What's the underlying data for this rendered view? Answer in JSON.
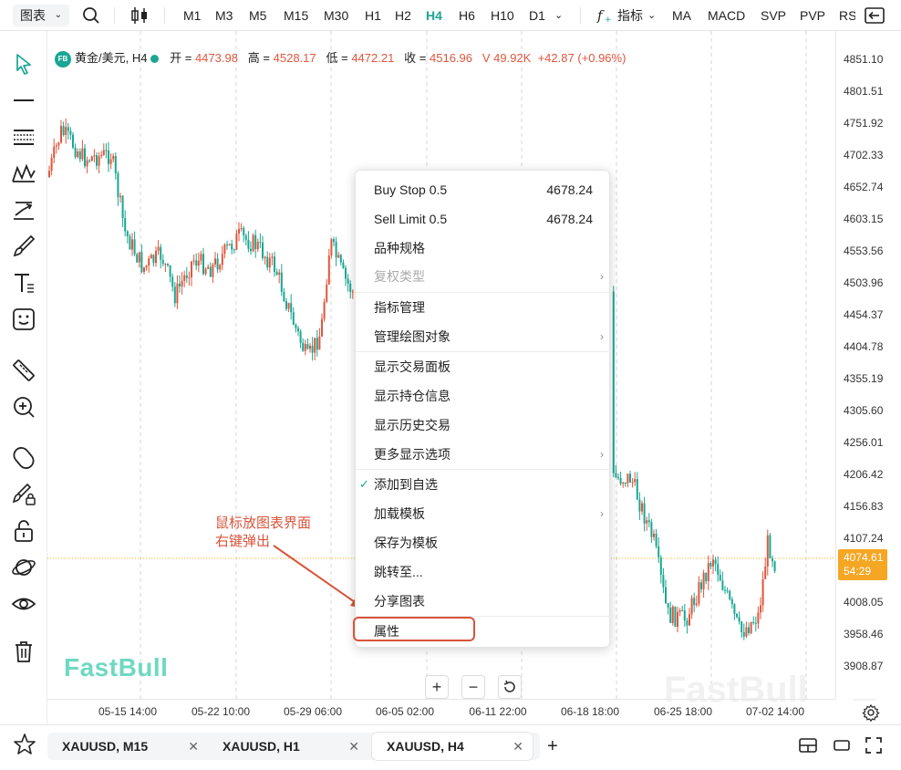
{
  "toolbar": {
    "chart_type_label": "图表",
    "timeframes": [
      "M1",
      "M3",
      "M5",
      "M15",
      "M30",
      "H1",
      "H2",
      "H4",
      "H6",
      "H10",
      "D1"
    ],
    "active_timeframe": "H4",
    "indicators_label": "指标",
    "quick_indicators": [
      "MA",
      "MACD",
      "SVP",
      "PVP",
      "RS"
    ]
  },
  "legend": {
    "badge": "FB",
    "symbol": "黄金/美元, H4",
    "open_label": "开 =",
    "open": "4473.98",
    "high_label": "高 =",
    "high": "4528.17",
    "low_label": "低 =",
    "low": "4472.21",
    "close_label": "收 =",
    "close": "4516.96",
    "vol_label": "V",
    "vol": "49.92K",
    "change": "+42.87 (+0.96%)"
  },
  "price_scale": [
    "4851.10",
    "4801.51",
    "4751.92",
    "4702.33",
    "4652.74",
    "4603.15",
    "4553.56",
    "4503.96",
    "4454.37",
    "4404.78",
    "4355.19",
    "4305.60",
    "4256.01",
    "4206.42",
    "4156.83",
    "4107.24",
    "4008.05",
    "3958.46",
    "3908.87"
  ],
  "last_price": {
    "price": "4074.61",
    "countdown": "54:29"
  },
  "time_scale": [
    "05-15 14:00",
    "05-22 10:00",
    "05-29 06:00",
    "06-05 02:00",
    "06-11 22:00",
    "06-18 18:00",
    "06-25 18:00",
    "07-02 14:00"
  ],
  "context_menu": {
    "items": [
      {
        "label": "Buy Stop 0.5",
        "value": "4678.24"
      },
      {
        "label": "Sell Limit 0.5",
        "value": "4678.24"
      },
      {
        "label": "品种规格"
      },
      {
        "label": "复权类型",
        "disabled": true
      },
      {
        "label": "指标管理"
      },
      {
        "label": "管理绘图对象"
      },
      {
        "label": "显示交易面板"
      },
      {
        "label": "显示持仓信息"
      },
      {
        "label": "显示历史交易"
      },
      {
        "label": "更多显示选项"
      },
      {
        "label": "添加到自选",
        "checked": true
      },
      {
        "label": "加载模板"
      },
      {
        "label": "保存为模板"
      },
      {
        "label": "跳转至..."
      },
      {
        "label": "分享图表"
      },
      {
        "label": "属性"
      }
    ]
  },
  "annotation": {
    "line1": "鼠标放图表界面",
    "line2": "右键弹出"
  },
  "watermark": {
    "brand": "FastBull",
    "faded": "FastBull"
  },
  "tabs": [
    {
      "label": "XAUUSD, M15",
      "active": false
    },
    {
      "label": "XAUUSD, H1",
      "active": false
    },
    {
      "label": "XAUUSD, H4",
      "active": true
    }
  ],
  "colors": {
    "up": "#e0563d",
    "down": "#1aa693",
    "accent": "#1aa693",
    "last_price_bg": "#f5a623",
    "annotation": "#d8543a"
  }
}
